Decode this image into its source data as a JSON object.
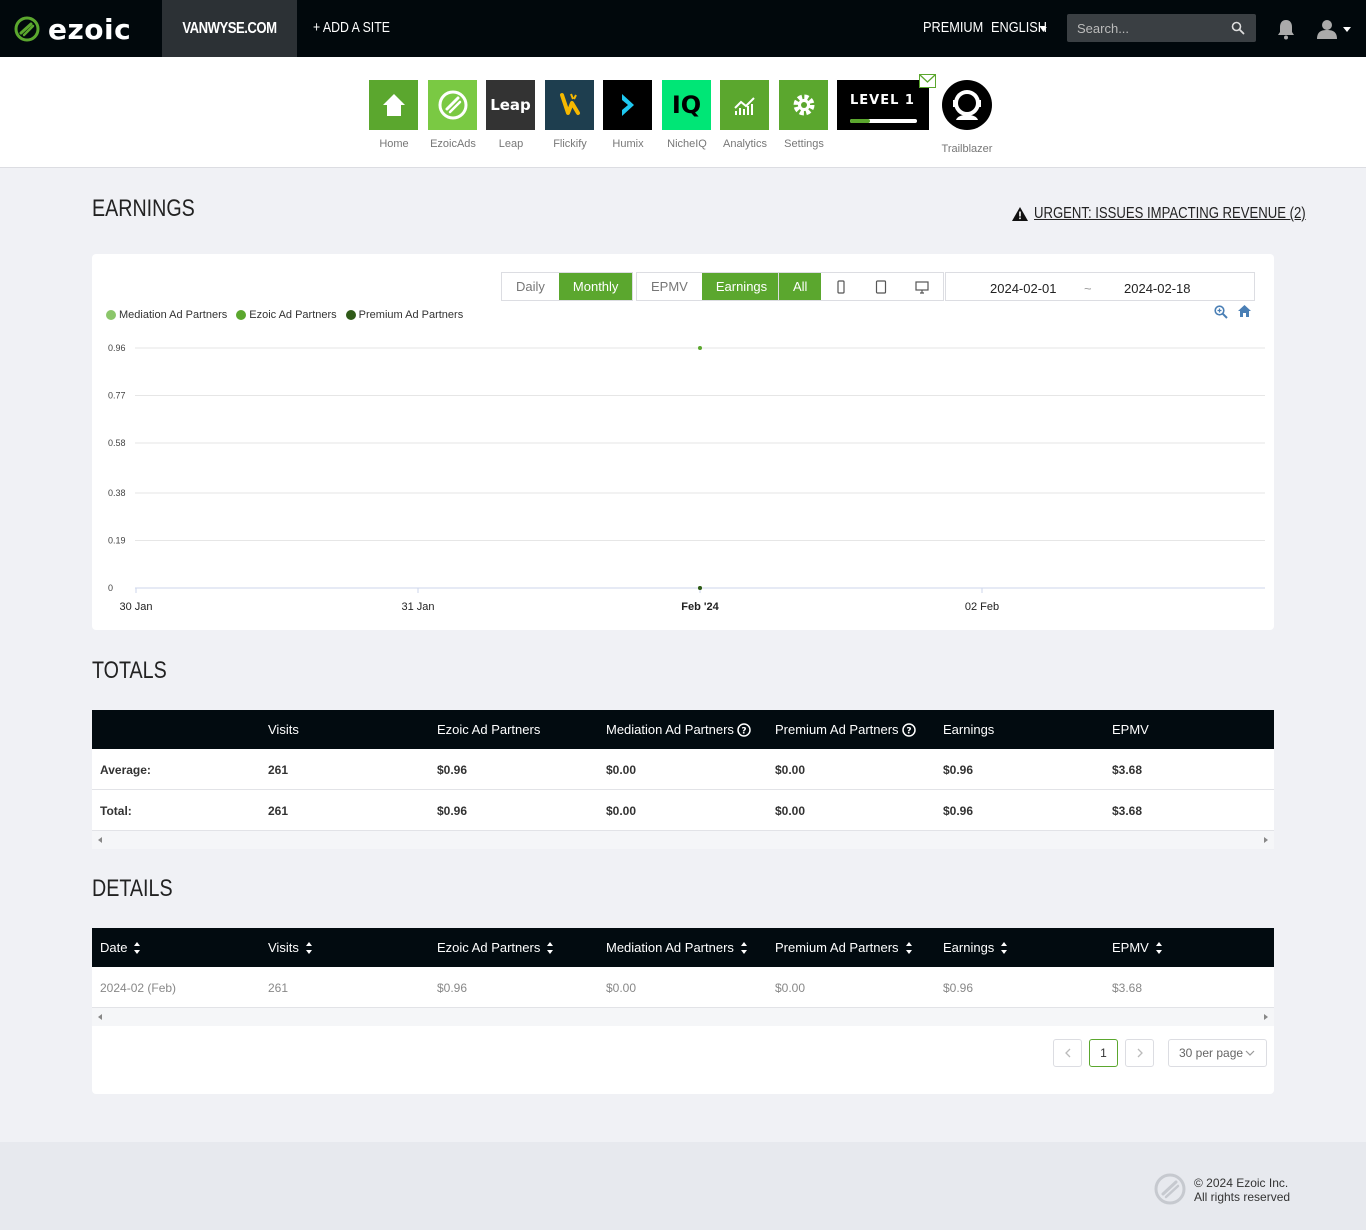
{
  "nav": {
    "logo_text": "ezoic",
    "site": "VANWYSE.COM",
    "add_site": "+ ADD A SITE",
    "premium": "PREMIUM",
    "language": "ENGLISH",
    "search_placeholder": "Search..."
  },
  "apps": [
    {
      "label": "Home",
      "color": "#5ba72e",
      "icon": "home-icon"
    },
    {
      "label": "EzoicAds",
      "color": "#7ac943",
      "icon": "ezoicads-icon"
    },
    {
      "label": "Leap",
      "color": "#333333",
      "icon": "leap-icon",
      "tile_text": "Leap"
    },
    {
      "label": "Flickify",
      "color": "#1e3e4f",
      "icon": "flickify-icon"
    },
    {
      "label": "Humix",
      "color": "#000000",
      "icon": "humix-icon"
    },
    {
      "label": "NicheIQ",
      "color": "#00e676",
      "icon": "nicheiq-icon",
      "tile_text": "IQ"
    },
    {
      "label": "Analytics",
      "color": "#5ba72e",
      "icon": "analytics-icon"
    },
    {
      "label": "Settings",
      "color": "#5ba72e",
      "icon": "gear-icon"
    }
  ],
  "level": {
    "text": "LEVEL 1",
    "progress": 0.3
  },
  "trailblazer": {
    "label": "Trailblazer"
  },
  "earnings": {
    "title": "EARNINGS",
    "urgent_link": "URGENT: ISSUES IMPACTING REVENUE (2)",
    "period_buttons": [
      "Daily",
      "Monthly"
    ],
    "period_active": "Monthly",
    "metric_buttons": [
      "EPMV",
      "Earnings"
    ],
    "metric_active": "Earnings",
    "device_all": "All",
    "date_from": "2024-02-01",
    "date_sep": "~",
    "date_to": "2024-02-18"
  },
  "chart_data": {
    "type": "line",
    "title": "",
    "xlabel": "",
    "ylabel": "",
    "legend": "top-left",
    "grid": true,
    "x_ticks": [
      "30 Jan",
      "31 Jan",
      "Feb '24",
      "02 Feb"
    ],
    "y_ticks": [
      0,
      0.19,
      0.38,
      0.58,
      0.77,
      0.96
    ],
    "ylim": [
      0,
      0.96
    ],
    "series": [
      {
        "name": "Mediation Ad Partners",
        "color": "#8bc66a",
        "points": [
          {
            "x": "Feb '24",
            "y": 0
          }
        ]
      },
      {
        "name": "Ezoic Ad Partners",
        "color": "#5ba72e",
        "points": [
          {
            "x": "Feb '24",
            "y": 0.96
          }
        ]
      },
      {
        "name": "Premium Ad Partners",
        "color": "#2f5a18",
        "points": [
          {
            "x": "Feb '24",
            "y": 0
          }
        ]
      }
    ]
  },
  "totals": {
    "title": "TOTALS",
    "columns": [
      "",
      "Visits",
      "Ezoic Ad Partners",
      "Mediation Ad Partners",
      "Premium Ad Partners",
      "Earnings",
      "EPMV"
    ],
    "rows": [
      [
        "Average:",
        "261",
        "$0.96",
        "$0.00",
        "$0.00",
        "$0.96",
        "$3.68"
      ],
      [
        "Total:",
        "261",
        "$0.96",
        "$0.00",
        "$0.00",
        "$0.96",
        "$3.68"
      ]
    ]
  },
  "details": {
    "title": "DETAILS",
    "columns": [
      "Date",
      "Visits",
      "Ezoic Ad Partners",
      "Mediation Ad Partners",
      "Premium Ad Partners",
      "Earnings",
      "EPMV"
    ],
    "rows": [
      [
        "2024-02 (Feb)",
        "261",
        "$0.96",
        "$0.00",
        "$0.00",
        "$0.96",
        "$3.68"
      ]
    ],
    "page": "1",
    "per_page": "30 per page"
  },
  "footer": {
    "copyright": "© 2024 Ezoic Inc.",
    "rights": "All rights reserved"
  }
}
